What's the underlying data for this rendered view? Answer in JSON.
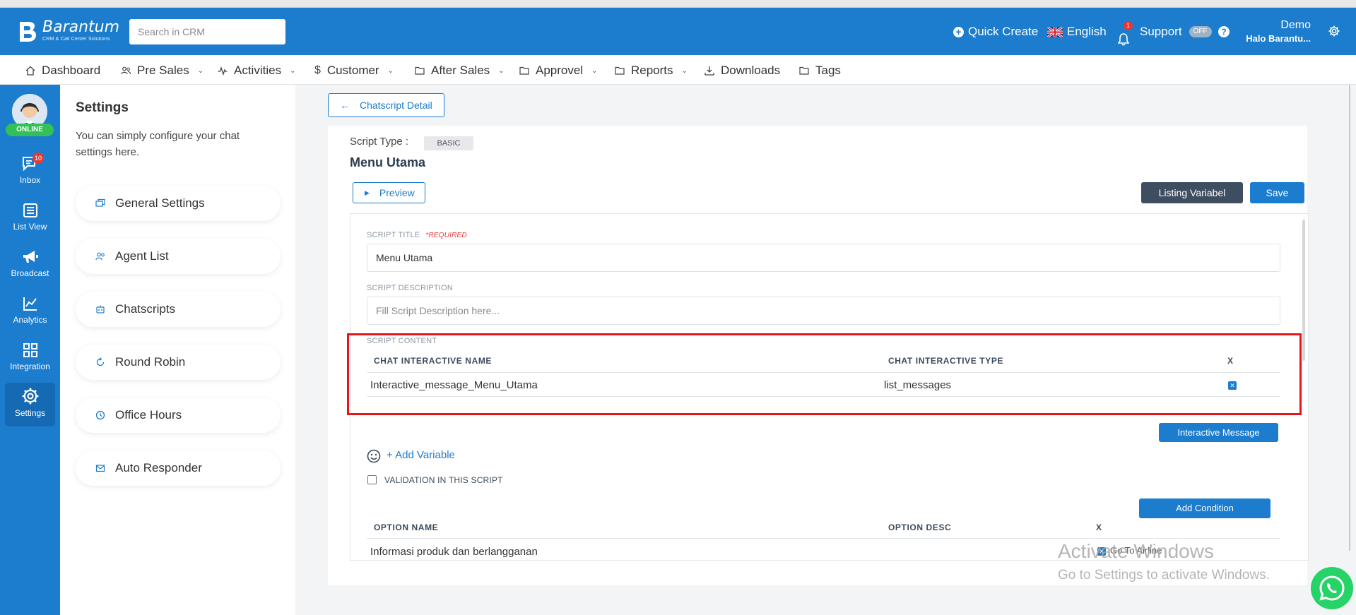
{
  "topbar": {
    "brand": "Barantum",
    "tagline": "CRM & Call Center Solutions",
    "search_placeholder": "Search in CRM",
    "quick_create": "Quick Create",
    "language": "English",
    "notification_count": "1",
    "support": "Support",
    "support_toggle": "OFF",
    "user_name": "Demo",
    "user_company": "Halo Barantu..."
  },
  "nav": {
    "items": [
      {
        "label": "Dashboard",
        "icon": "home-icon"
      },
      {
        "label": "Pre Sales",
        "icon": "users-icon"
      },
      {
        "label": "Activities",
        "icon": "activity-icon"
      },
      {
        "label": "Customer",
        "icon": "dollar-icon"
      },
      {
        "label": "After Sales",
        "icon": "folder-icon"
      },
      {
        "label": "Approvel",
        "icon": "folder-icon"
      },
      {
        "label": "Reports",
        "icon": "folder-icon"
      },
      {
        "label": "Downloads",
        "icon": "download-icon"
      },
      {
        "label": "Tags",
        "icon": "folder-icon"
      }
    ]
  },
  "rail": {
    "status": "ONLINE",
    "inbox_badge": "10",
    "items": [
      {
        "label": "Inbox",
        "icon": "chat-icon"
      },
      {
        "label": "List View",
        "icon": "list-icon"
      },
      {
        "label": "Broadcast",
        "icon": "megaphone-icon"
      },
      {
        "label": "Analytics",
        "icon": "chart-icon"
      },
      {
        "label": "Integration",
        "icon": "grid-icon"
      },
      {
        "label": "Settings",
        "icon": "gear-icon"
      }
    ]
  },
  "settings": {
    "title": "Settings",
    "description": "You can simply configure your chat settings here.",
    "items": [
      {
        "label": "General Settings",
        "icon": "chat-bubbles-icon"
      },
      {
        "label": "Agent List",
        "icon": "users-icon"
      },
      {
        "label": "Chatscripts",
        "icon": "robot-icon"
      },
      {
        "label": "Round Robin",
        "icon": "refresh-icon"
      },
      {
        "label": "Office Hours",
        "icon": "clock-icon"
      },
      {
        "label": "Auto Responder",
        "icon": "mail-icon"
      }
    ]
  },
  "main": {
    "back_label": "Chatscript Detail",
    "script_type_label": "Script Type :",
    "script_type": "BASIC",
    "title": "Menu Utama",
    "preview_label": "Preview",
    "listing_label": "Listing Variabel",
    "save_label": "Save",
    "script_title_label": "SCRIPT TITLE",
    "required_label": "*REQUIRED",
    "script_title_value": "Menu Utama",
    "script_description_label": "SCRIPT DESCRIPTION",
    "script_description_placeholder": "Fill Script Description here...",
    "script_content_label": "SCRIPT CONTENT",
    "content_table": {
      "headers": [
        "CHAT INTERACTIVE NAME",
        "CHAT INTERACTIVE TYPE",
        "X"
      ],
      "rows": [
        {
          "name": "Interactive_message_Menu_Utama",
          "type": "list_messages"
        }
      ]
    },
    "interactive_message_label": "Interactive Message",
    "add_variable_label": "+ Add Variable",
    "validation_label": "VALIDATION IN THIS SCRIPT",
    "add_condition_label": "Add Condition",
    "option_table": {
      "headers": [
        "OPTION NAME",
        "OPTION DESC",
        "X"
      ],
      "rows": [
        {
          "name": "Informasi produk dan berlangganan",
          "extra": "Go To Airline"
        }
      ]
    }
  },
  "watermark": {
    "line1": "Activate Windows",
    "line2": "Go to Settings to activate Windows."
  },
  "colors": {
    "primary": "#1c7ccd",
    "online": "#33c157",
    "highlight": "#e8141c",
    "dark_button": "#3f4d61"
  }
}
